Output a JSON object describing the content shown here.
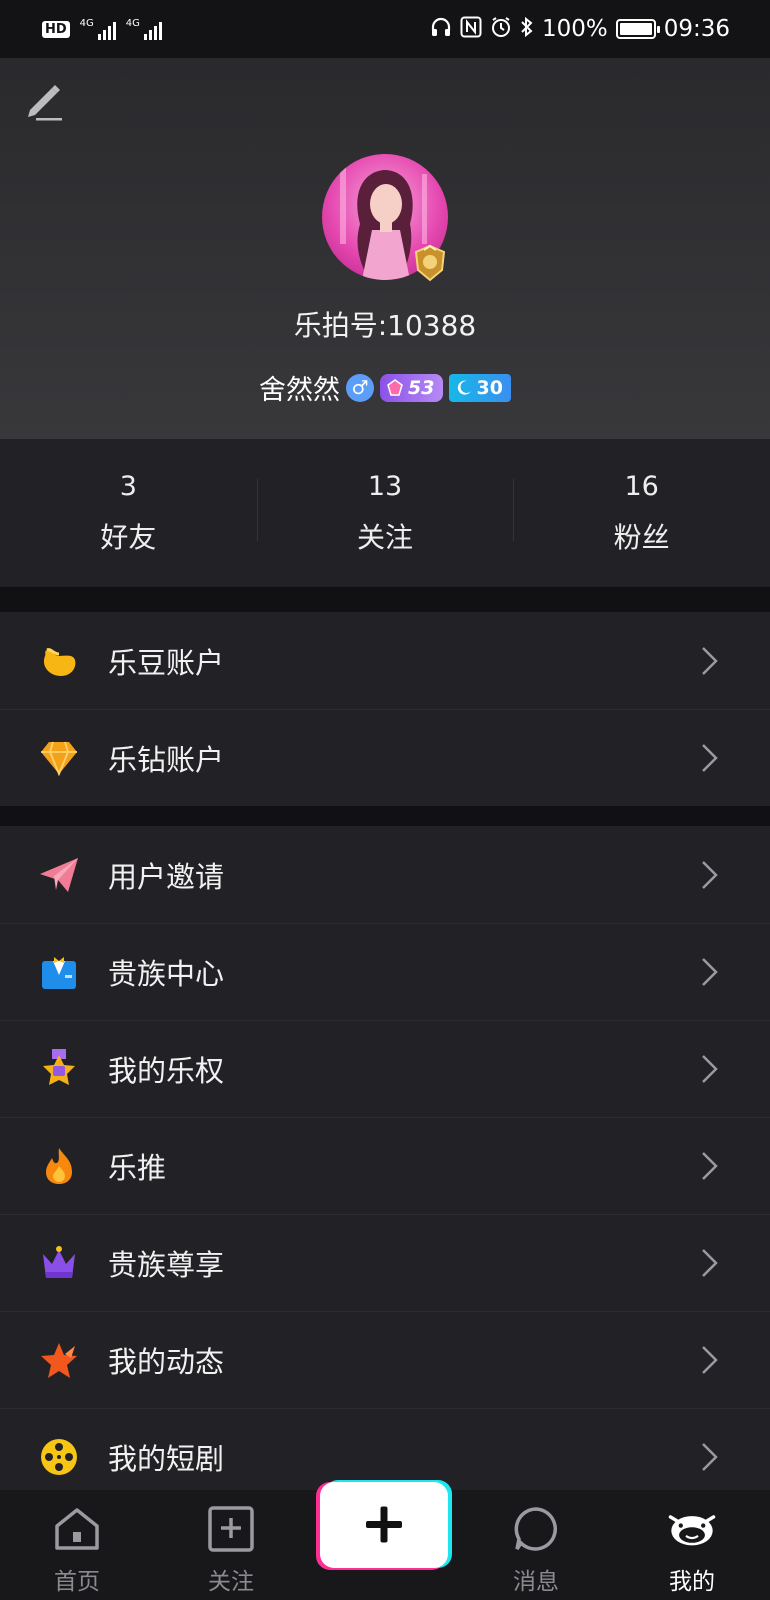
{
  "status_bar": {
    "hd_label": "HD",
    "sim1_label": "4G",
    "sim2_label": "4G",
    "battery_percent": "100%",
    "time": "09:36",
    "icons": [
      "headphones-icon",
      "nfc-icon",
      "alarm-icon",
      "bluetooth-icon",
      "battery-icon"
    ]
  },
  "profile": {
    "user_id": "乐拍号:10388",
    "username": "舍然然",
    "gender_symbol": "♂",
    "wealth_level": "53",
    "charm_level": "30"
  },
  "stats": [
    {
      "value": "3",
      "label": "好友"
    },
    {
      "value": "13",
      "label": "关注"
    },
    {
      "value": "16",
      "label": "粉丝"
    }
  ],
  "account_menu": [
    {
      "label": "乐豆账户",
      "icon": "bean-icon"
    },
    {
      "label": "乐钻账户",
      "icon": "diamond-icon"
    }
  ],
  "feature_menu": [
    {
      "label": "用户邀请",
      "icon": "paper-plane-icon"
    },
    {
      "label": "贵族中心",
      "icon": "noble-suit-icon"
    },
    {
      "label": "我的乐权",
      "icon": "rights-medal-icon"
    },
    {
      "label": "乐推",
      "icon": "flame-icon"
    },
    {
      "label": "贵族尊享",
      "icon": "crown-icon"
    },
    {
      "label": "我的动态",
      "icon": "star-icon"
    },
    {
      "label": "我的短剧",
      "icon": "film-reel-icon"
    }
  ],
  "bottom_nav": [
    {
      "label": "首页",
      "icon": "home-icon"
    },
    {
      "label": "关注",
      "icon": "follow-icon"
    },
    {
      "label": "消息",
      "icon": "message-icon"
    },
    {
      "label": "我的",
      "icon": "cow-face-icon",
      "active": true
    }
  ],
  "colors": {
    "background": "#111113",
    "panel": "#222226",
    "accent_pink": "#ff2e93",
    "accent_cyan": "#1ee6ef"
  }
}
